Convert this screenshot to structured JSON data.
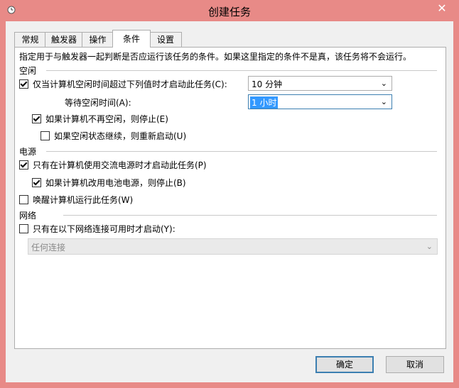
{
  "window": {
    "title": "创建任务"
  },
  "tabs": [
    {
      "label": "常规"
    },
    {
      "label": "触发器"
    },
    {
      "label": "操作"
    },
    {
      "label": "条件"
    },
    {
      "label": "设置"
    }
  ],
  "active_tab": "条件",
  "intro": "指定用于与触发器一起判断是否应运行该任务的条件。如果这里指定的条件不是真，该任务将不会运行。",
  "idle": {
    "section": "空闲",
    "start_if_idle": {
      "label": "仅当计算机空闲时间超过下列值时才启动此任务(C):",
      "checked": true
    },
    "idle_duration": "10 分钟",
    "wait_label": "等待空闲时间(A):",
    "wait_duration": "1 小时",
    "stop_if_not_idle": {
      "label": "如果计算机不再空闲，则停止(E)",
      "checked": true
    },
    "restart_if_idle": {
      "label": "如果空闲状态继续，则重新启动(U)",
      "checked": false
    }
  },
  "power": {
    "section": "电源",
    "start_on_ac": {
      "label": "只有在计算机使用交流电源时才启动此任务(P)",
      "checked": true
    },
    "stop_on_battery": {
      "label": "如果计算机改用电池电源，则停止(B)",
      "checked": true
    },
    "wake": {
      "label": "唤醒计算机运行此任务(W)",
      "checked": false
    }
  },
  "network": {
    "section": "网络",
    "start_if_network": {
      "label": "只有在以下网络连接可用时才启动(Y):",
      "checked": false
    },
    "connection": "任何连接"
  },
  "buttons": {
    "ok": "确定",
    "cancel": "取消"
  }
}
